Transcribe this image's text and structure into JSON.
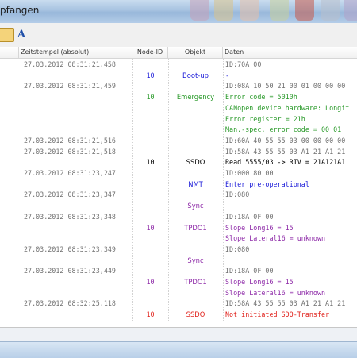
{
  "window": {
    "title": "pfangen"
  },
  "colors": {
    "green": "#2a9a2a",
    "blue": "#1a1ad8",
    "purple": "#8e2aa8",
    "red": "#e0201a",
    "gray": "#707070"
  },
  "toolbar": {
    "tool1_icon": "settings-tool-icon",
    "tool2_icon": "font-icon",
    "tool2_label": "A"
  },
  "columns": [
    "",
    "Zeitstempel (absolut)",
    "Node-ID",
    "Objekt",
    "Daten"
  ],
  "rows": [
    {
      "time": "27.03.2012  08:31:21,458",
      "node": "",
      "object": "",
      "data": "ID:70A  00",
      "color": "gray"
    },
    {
      "time": "",
      "node": "10",
      "object": "Boot-up",
      "data": "-",
      "color": "blue"
    },
    {
      "time": "27.03.2012  08:31:21,459",
      "node": "",
      "object": "",
      "data": "ID:08A  10 50 21 00 01 00 00 00",
      "color": "gray"
    },
    {
      "time": "",
      "node": "10",
      "object": "Emergency",
      "data": "Error code = 5010h",
      "color": "green"
    },
    {
      "time": "",
      "node": "",
      "object": "",
      "data": "CANopen device hardware: Longit",
      "color": "green"
    },
    {
      "time": "",
      "node": "",
      "object": "",
      "data": "Error register = 21h",
      "color": "green"
    },
    {
      "time": "",
      "node": "",
      "object": "",
      "data": "Man.-spec. error code = 00 01",
      "color": "green"
    },
    {
      "time": "27.03.2012  08:31:21,516",
      "node": "",
      "object": "",
      "data": "ID:60A  40 55 55 03 00 00 00 00",
      "color": "gray"
    },
    {
      "time": "27.03.2012  08:31:21,518",
      "node": "",
      "object": "",
      "data": "ID:58A  43 55 55 03 A1 21 A1 21",
      "color": "gray"
    },
    {
      "time": "",
      "node": "10",
      "object": "SSDO",
      "data": "Read  5555/03 -> RIV = 21A121A1",
      "color": "black"
    },
    {
      "time": "27.03.2012  08:31:23,247",
      "node": "",
      "object": "",
      "data": "ID:000  80 00",
      "color": "gray"
    },
    {
      "time": "",
      "node": "",
      "object": "NMT",
      "data": "Enter pre-operational",
      "color": "blue"
    },
    {
      "time": "27.03.2012  08:31:23,347",
      "node": "",
      "object": "",
      "data": "ID:080",
      "color": "gray"
    },
    {
      "time": "",
      "node": "",
      "object": "Sync",
      "data": "",
      "color": "purple"
    },
    {
      "time": "27.03.2012  08:31:23,348",
      "node": "",
      "object": "",
      "data": "ID:18A  0F 00",
      "color": "gray"
    },
    {
      "time": "",
      "node": "10",
      "object": "TPDO1",
      "data": "Slope Long16 = 15",
      "color": "purple"
    },
    {
      "time": "",
      "node": "",
      "object": "",
      "data": "Slope Lateral16 = unknown",
      "color": "purple"
    },
    {
      "time": "27.03.2012  08:31:23,349",
      "node": "",
      "object": "",
      "data": "ID:080",
      "color": "gray"
    },
    {
      "time": "",
      "node": "",
      "object": "Sync",
      "data": "",
      "color": "purple"
    },
    {
      "time": "27.03.2012  08:31:23,449",
      "node": "",
      "object": "",
      "data": "ID:18A  0F 00",
      "color": "gray"
    },
    {
      "time": "",
      "node": "10",
      "object": "TPDO1",
      "data": "Slope Long16 = 15",
      "color": "purple"
    },
    {
      "time": "",
      "node": "",
      "object": "",
      "data": "Slope Lateral16 = unknown",
      "color": "purple"
    },
    {
      "time": "27.03.2012  08:32:25,118",
      "node": "",
      "object": "",
      "data": "ID:58A  43 55 55 03 A1 21 A1 21",
      "color": "gray"
    },
    {
      "time": "",
      "node": "10",
      "object": "SSDO",
      "data": "Not initiated SDO-Transfer",
      "color": "red"
    }
  ]
}
